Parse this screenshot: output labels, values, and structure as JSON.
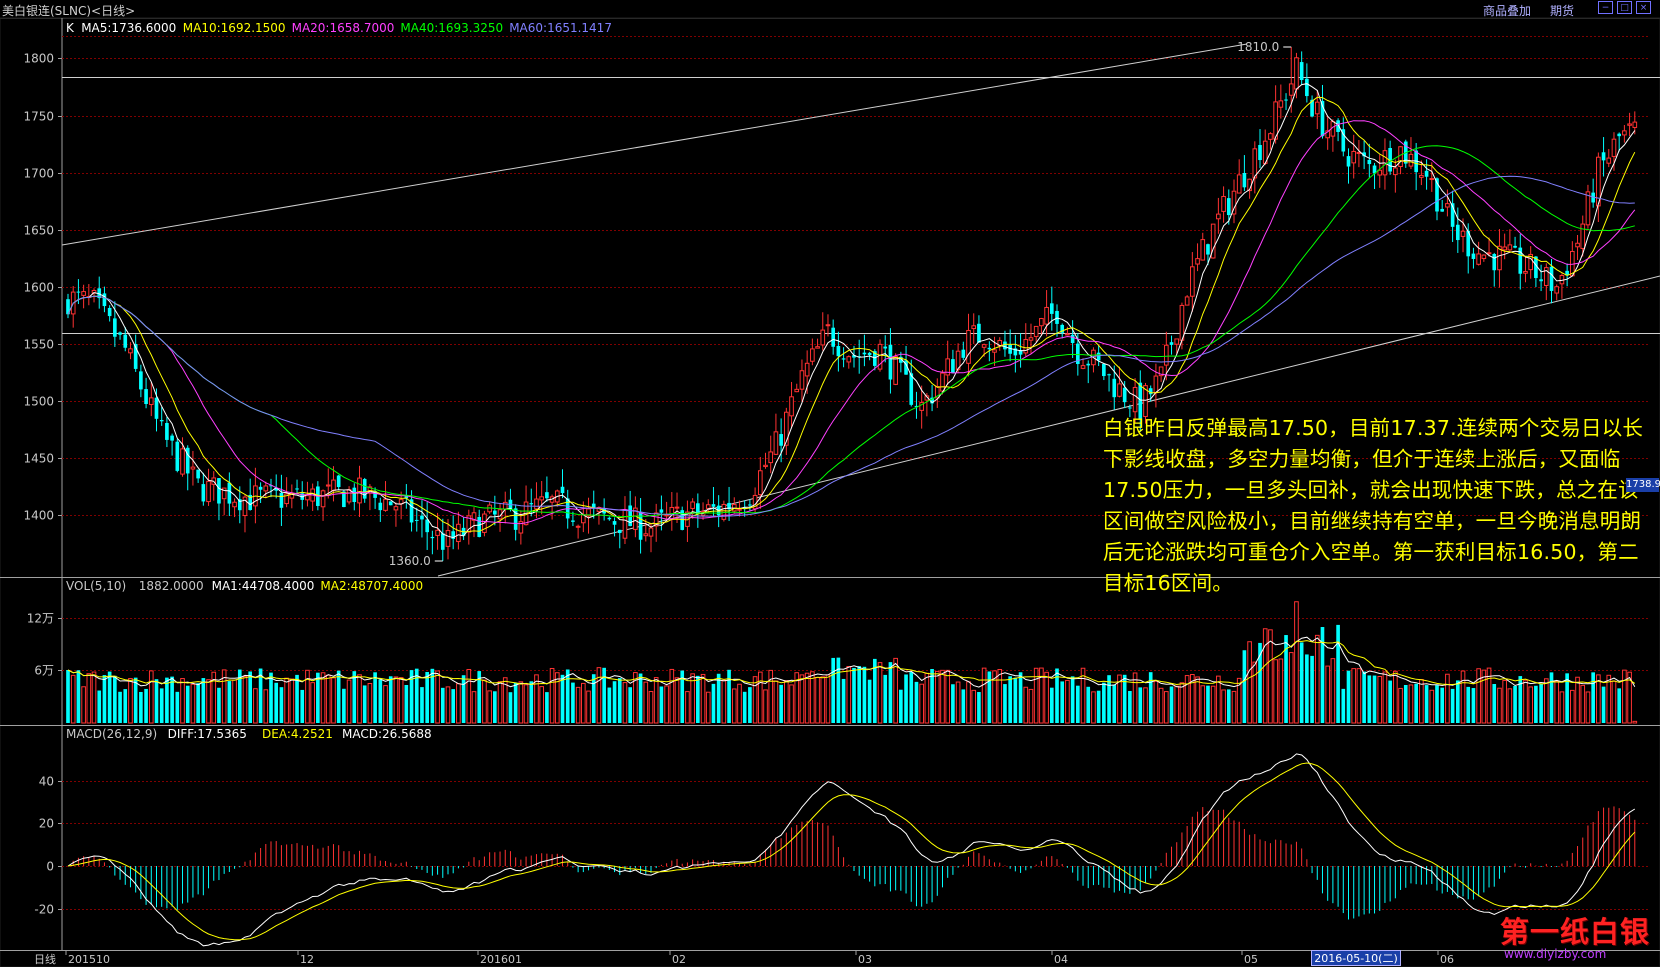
{
  "window": {
    "title": "美白银连(SLNC)<日线>",
    "links": [
      "商品叠加",
      "期货"
    ],
    "buttons": [
      "−",
      "□",
      "×"
    ]
  },
  "main_panel": {
    "legend": [
      {
        "label": "K",
        "color": "#ffffff"
      },
      {
        "label": "MA5:1736.6000",
        "color": "#ffffff"
      },
      {
        "label": "MA10:1692.1500",
        "color": "#ffff00"
      },
      {
        "label": "MA20:1658.7000",
        "color": "#ff40ff"
      },
      {
        "label": "MA40:1693.3250",
        "color": "#00ff00"
      },
      {
        "label": "MA60:1651.1417",
        "color": "#8080ff"
      }
    ],
    "y_ticks": [
      "1800",
      "1750",
      "1700",
      "1650",
      "1600",
      "1550",
      "1500",
      "1450",
      "1400"
    ],
    "high_label": "1810.0",
    "low_label": "1360.0",
    "current_price_badge": "1738.9"
  },
  "volume_panel": {
    "legend": [
      {
        "label": "VOL(5,10)",
        "color": "#c8c8c8"
      },
      {
        "label": "1882.0000",
        "color": "#c8c8c8"
      },
      {
        "label": "MA1:44708.4000",
        "color": "#ffffff"
      },
      {
        "label": "MA2:48707.4000",
        "color": "#ffff00"
      }
    ],
    "y_ticks": [
      "12万",
      "6万"
    ]
  },
  "macd_panel": {
    "legend": [
      {
        "label": "MACD(26,12,9)",
        "color": "#c8c8c8"
      },
      {
        "label": "DIFF:17.5365",
        "color": "#ffffff"
      },
      {
        "label": "DEA:4.2521",
        "color": "#ffff00"
      },
      {
        "label": "MACD:26.5688",
        "color": "#ffffff"
      }
    ],
    "y_ticks": [
      "40",
      "20",
      "0",
      "-20"
    ]
  },
  "x_axis": {
    "period_label": "日线",
    "ticks": [
      "201510",
      "12",
      "201601",
      "02",
      "03",
      "04",
      "05",
      "06"
    ],
    "cursor_date": "2016-05-10(二)"
  },
  "comment": "白银昨日反弹最高17.50，目前17.37.连续两个交易日以长下影线收盘，多空力量均衡，但介于连续上涨后，又面临17.50压力，一旦多头回补，就会出现快速下跌，总之在该区间做空风险极小，目前继续持有空单，一旦今晚消息明朗后无论涨跌均可重仓介入空单。第一获利目标16.50，第二目标16区间。",
  "watermark": {
    "main": "第一纸白银",
    "url": "www.diyizby.com"
  },
  "colors": {
    "up": "#ff3232",
    "down": "#00ffff",
    "ma5": "#ffffff",
    "ma10": "#ffff00",
    "ma20": "#ff40ff",
    "ma40": "#00ff00",
    "ma60": "#8080ff",
    "grid": "#800000"
  },
  "chart_data": [
    {
      "type": "candlestick",
      "title": "美白银连(SLNC)<日线>",
      "ylim": [
        1350,
        1830
      ],
      "x_ticks": [
        "201510",
        "12",
        "201601",
        "02",
        "03",
        "04",
        "05",
        "06"
      ],
      "anchors": [
        {
          "date": "2015-10 start",
          "close": 1590
        },
        {
          "date": "2015-10 end",
          "close": 1430
        },
        {
          "date": "2015-11",
          "close": 1410
        },
        {
          "date": "2015-12 low",
          "low": 1360
        },
        {
          "date": "2016-01",
          "close": 1390
        },
        {
          "date": "2016-02",
          "close": 1410
        },
        {
          "date": "2016-02 end",
          "close": 1560
        },
        {
          "date": "2016-03",
          "close": 1480
        },
        {
          "date": "2016-04 start",
          "close": 1500
        },
        {
          "date": "2016-05 high",
          "high": 1810
        },
        {
          "date": "2016-05-10",
          "close": 1750
        },
        {
          "date": "2016-06 start",
          "close": 1640
        },
        {
          "date": "2016-06 low",
          "low": 1590
        },
        {
          "date": "2016-06 last",
          "close": 1738.9
        }
      ],
      "ma_last": {
        "MA5": 1736.6,
        "MA10": 1692.15,
        "MA20": 1658.7,
        "MA40": 1693.325,
        "MA60": 1651.1417
      }
    },
    {
      "type": "bar",
      "title": "VOL(5,10)",
      "ylim": [
        0,
        140000
      ],
      "last": {
        "VOL": 1882,
        "MA1": 44708.4,
        "MA2": 48707.4
      }
    },
    {
      "type": "bar",
      "title": "MACD(26,12,9)",
      "ylim": [
        -35,
        60
      ],
      "last": {
        "DIFF": 17.5365,
        "DEA": 4.2521,
        "MACD": 26.5688
      }
    }
  ]
}
